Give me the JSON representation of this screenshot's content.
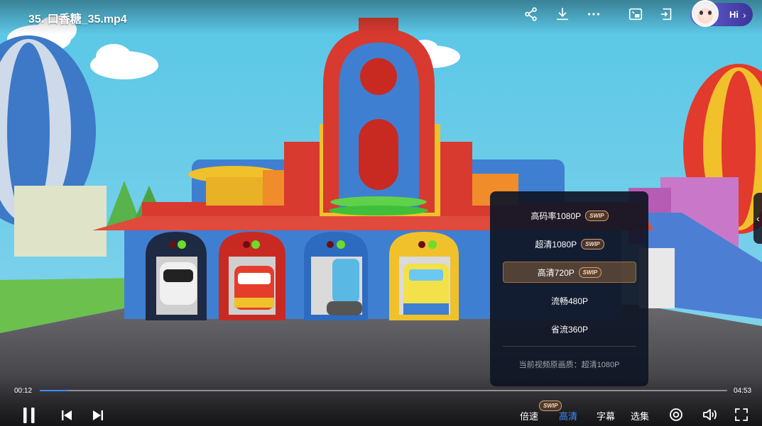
{
  "video": {
    "title": "35. 口香糖_35.mp4"
  },
  "top_actions": {
    "share": "share-icon",
    "download": "download-icon",
    "more": "more-icon",
    "pip": "picture-in-picture-icon",
    "cast": "cast-icon"
  },
  "user": {
    "greeting": "Hi",
    "chevron": "›"
  },
  "quality_menu": {
    "items": [
      {
        "label": "高码率1080P",
        "badge": "SWIP",
        "selected": false
      },
      {
        "label": "超清1080P",
        "badge": "SWIP",
        "selected": false
      },
      {
        "label": "高清720P",
        "badge": "SWIP",
        "selected": true
      },
      {
        "label": "流畅480P",
        "badge": "",
        "selected": false
      },
      {
        "label": "省流360P",
        "badge": "",
        "selected": false
      }
    ],
    "note": "当前视频原画质：超清1080P"
  },
  "playback": {
    "current_time": "00:12",
    "duration": "04:53",
    "progress_fraction": 0.041
  },
  "controls": {
    "speed_label": "倍速",
    "speed_badge": "SWIP",
    "quality_label": "高清",
    "subtitle_label": "字幕",
    "episodes_label": "选集"
  },
  "side_handle": {
    "glyph": "‹"
  },
  "colors": {
    "accent": "#3f8cff",
    "menu_bg": "#101626",
    "selected_border": "#a46c3a"
  }
}
